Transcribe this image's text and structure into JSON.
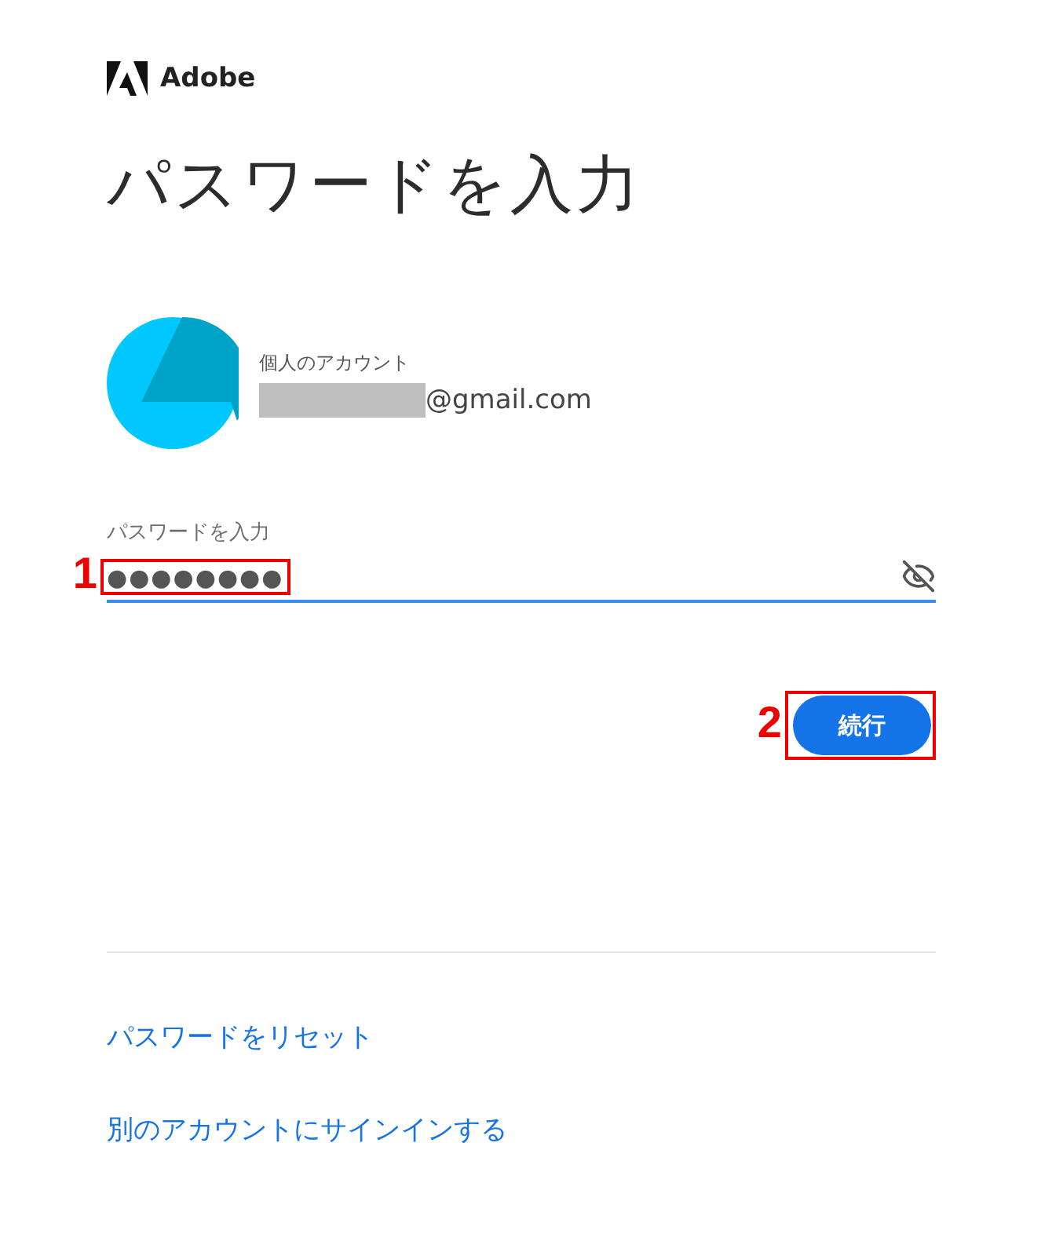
{
  "brand": {
    "name": "Adobe"
  },
  "title": "パスワードを入力",
  "account": {
    "type": "個人のアカウント",
    "email": "@gmail.com",
    "redacted": true
  },
  "password_field": {
    "label": "パスワードを入力",
    "value": "●●●●●●●●",
    "focused": true,
    "annotation": "1"
  },
  "continue_button": {
    "label": "続行",
    "annotation": "2"
  },
  "links": [
    {
      "label": "パスワードをリセット"
    },
    {
      "label": "別のアカウントにサインインする"
    }
  ]
}
